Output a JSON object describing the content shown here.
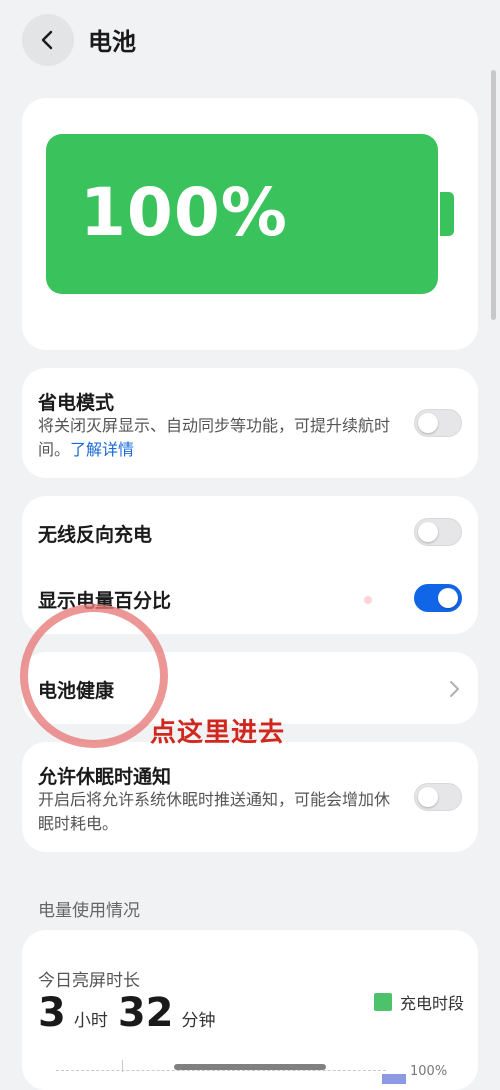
{
  "header": {
    "title": "电池"
  },
  "battery": {
    "percent_label": "100%",
    "level_percent": 100,
    "color": "#3ac35c"
  },
  "settings": {
    "power_saving": {
      "title": "省电模式",
      "desc": "将关闭灭屏显示、自动同步等功能，可提升续航时间。",
      "link": "了解详情",
      "enabled": false
    },
    "wireless_reverse": {
      "title": "无线反向充电",
      "enabled": false
    },
    "show_percentage": {
      "title": "显示电量百分比",
      "enabled": true
    },
    "battery_health": {
      "title": "电池健康"
    },
    "sleep_notify": {
      "title": "允许休眠时通知",
      "desc": "开启后将允许系统休眠时推送通知，可能会增加休眠时耗电。",
      "enabled": false
    }
  },
  "annotation": {
    "text": "点这里进去",
    "color": "#d0281e"
  },
  "usage": {
    "section_label": "电量使用情况",
    "screen_on_label": "今日亮屏时长",
    "hours": "3",
    "hours_unit": "小时",
    "minutes": "32",
    "minutes_unit": "分钟",
    "legend": "充电时段",
    "axis_max": "100%"
  },
  "colors": {
    "accent": "#1166e8",
    "link": "#1a6ad6",
    "battery_green": "#3ac35c"
  }
}
